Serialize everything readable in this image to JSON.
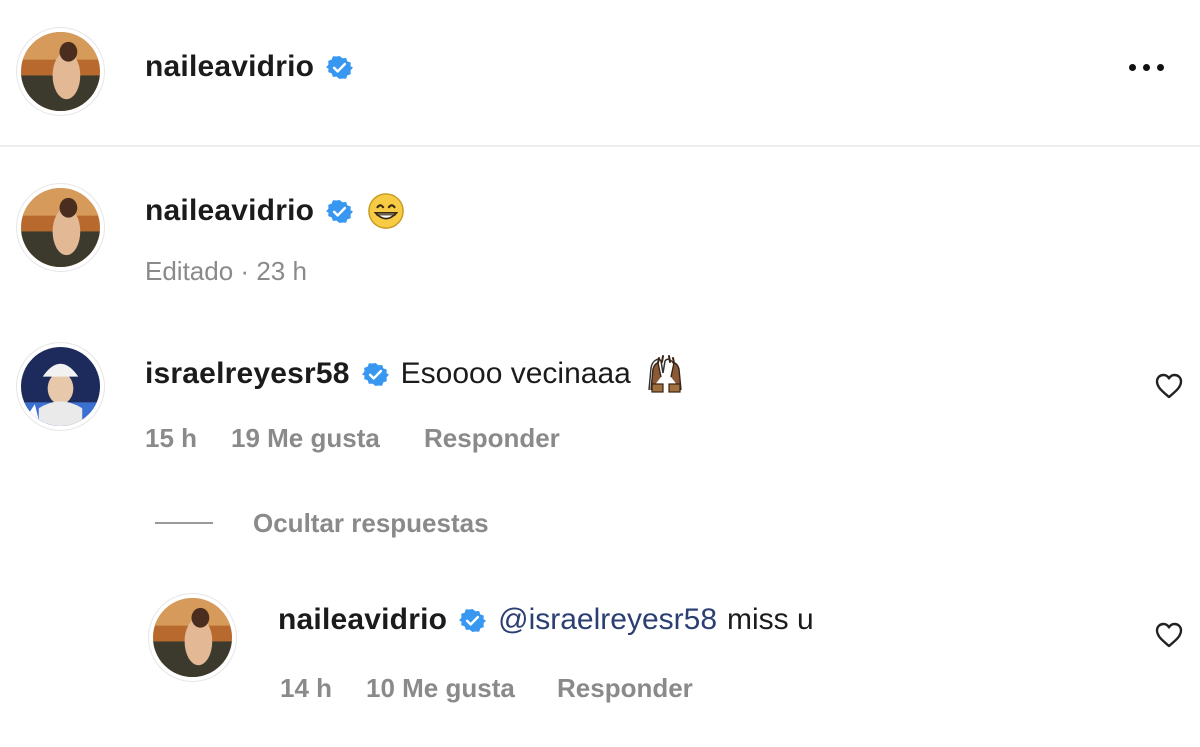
{
  "post_header": {
    "username": "naileavidrio",
    "more_icon": "more-horizontal-icon"
  },
  "caption": {
    "username": "naileavidrio",
    "emoji": "grinning-face-emoji",
    "edited_label": "Editado",
    "separator": "·",
    "time": "23 h"
  },
  "comments": [
    {
      "username": "israelreyesr58",
      "text": "Esoooo vecinaaa",
      "emoji": "raising-hands-emoji",
      "time": "15 h",
      "likes": "19 Me gusta",
      "reply_label": "Responder",
      "like_icon": "heart-outline-icon"
    }
  ],
  "replies_toggle": "Ocultar respuestas",
  "replies": [
    {
      "username": "naileavidrio",
      "mention": "@israelreyesr58",
      "text": "miss u",
      "time": "14 h",
      "likes": "10 Me gusta",
      "reply_label": "Responder",
      "like_icon": "heart-outline-icon"
    }
  ],
  "colors": {
    "verified_blue": "#3897f0",
    "mention_blue": "#2b3f72",
    "meta_gray": "#8a8a8a"
  }
}
